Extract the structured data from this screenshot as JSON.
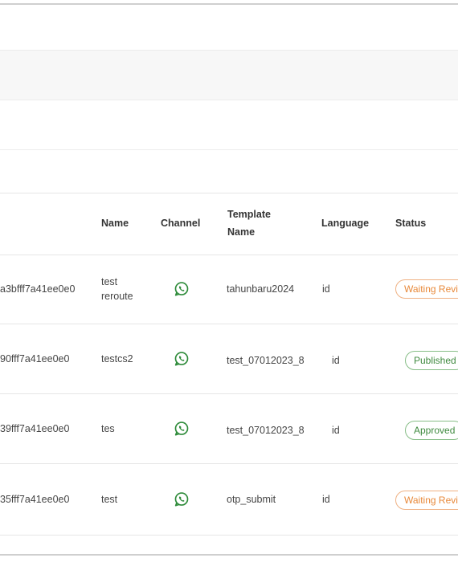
{
  "table": {
    "headers": {
      "name": "Name",
      "channel": "Channel",
      "template_name": "Template Name",
      "language": "Language",
      "status": "Status"
    },
    "rows": [
      {
        "id": "a3bfff7a41ee0e0",
        "name": "test reroute",
        "channel": "whatsapp-icon",
        "template_name": "tahunbaru2024",
        "language": "id",
        "status": "Waiting Revie",
        "status_type": "waiting"
      },
      {
        "id": "90fff7a41ee0e0",
        "name": "testcs2",
        "channel": "whatsapp-icon",
        "template_name": "test_07012023_8",
        "language": "id",
        "status": "Published",
        "status_type": "published"
      },
      {
        "id": "39fff7a41ee0e0",
        "name": "tes",
        "channel": "whatsapp-icon",
        "template_name": "test_07012023_8",
        "language": "id",
        "status": "Approved",
        "status_type": "approved"
      },
      {
        "id": "35fff7a41ee0e0",
        "name": "test",
        "channel": "whatsapp-icon",
        "template_name": "otp_submit",
        "language": "id",
        "status": "Waiting Revie",
        "status_type": "waiting"
      }
    ]
  },
  "colors": {
    "whatsapp": "#2e8b3a",
    "waiting": "#e8893a",
    "approved": "#3f8a3f",
    "border": "#e6e6e6"
  }
}
